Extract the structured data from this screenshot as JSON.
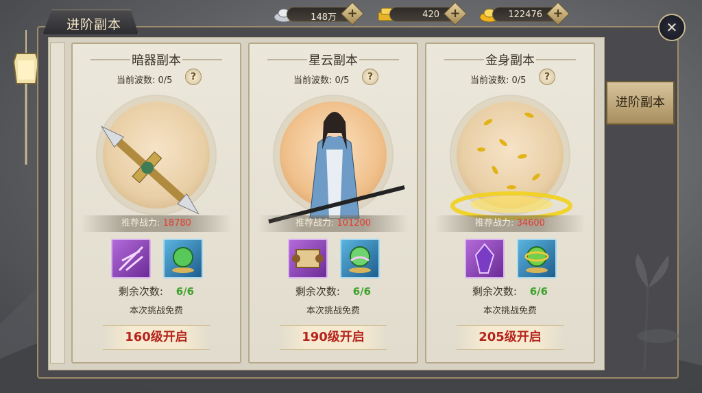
{
  "currencies": [
    {
      "name": "silver",
      "value": "148万",
      "icon": "silver-ingot-icon"
    },
    {
      "name": "gold",
      "value": "420",
      "icon": "gold-ingot-stack-icon"
    },
    {
      "name": "yuanbao",
      "value": "122476",
      "icon": "gold-ingot-icon"
    }
  ],
  "window": {
    "title": "进阶副本",
    "close_icon": "close-icon"
  },
  "side_tab": {
    "label": "进阶副本"
  },
  "cards": [
    {
      "name": "暗器副本",
      "wave_label": "当前波数: 0/5",
      "help": "?",
      "power_label": "推荐战力:",
      "power_value": "18780",
      "art": "hidden-weapon-dagger",
      "items": [
        {
          "icon": "purple-darts-icon",
          "rarity": "purple"
        },
        {
          "icon": "green-orb-icon",
          "rarity": "blue"
        }
      ],
      "remaining_label": "剩余次数:",
      "remaining_value": "6/6",
      "free_text": "本次挑战免费",
      "unlock_text": "160级开启"
    },
    {
      "name": "星云副本",
      "wave_label": "当前波数: 0/5",
      "help": "?",
      "power_label": "推荐战力:",
      "power_value": "101200",
      "art": "swordsman-with-flute",
      "items": [
        {
          "icon": "scroll-icon",
          "rarity": "purple"
        },
        {
          "icon": "green-lotus-orb-icon",
          "rarity": "blue"
        }
      ],
      "remaining_label": "剩余次数:",
      "remaining_value": "6/6",
      "free_text": "本次挑战免费",
      "unlock_text": "190级开启"
    },
    {
      "name": "金身副本",
      "wave_label": "当前波数: 0/5",
      "help": "?",
      "power_label": "推荐战力:",
      "power_value": "34600",
      "art": "golden-leaf-swirl",
      "items": [
        {
          "icon": "purple-crystal-icon",
          "rarity": "purple"
        },
        {
          "icon": "gold-ring-orb-icon",
          "rarity": "blue"
        }
      ],
      "remaining_label": "剩余次数:",
      "remaining_value": "6/6",
      "free_text": "本次挑战免费",
      "unlock_text": "205级开启"
    }
  ],
  "colors": {
    "power_value": "#e23a2e",
    "remaining_value": "#3fa12d",
    "unlock_text": "#b5241c",
    "frame_border": "#9d8c69"
  }
}
